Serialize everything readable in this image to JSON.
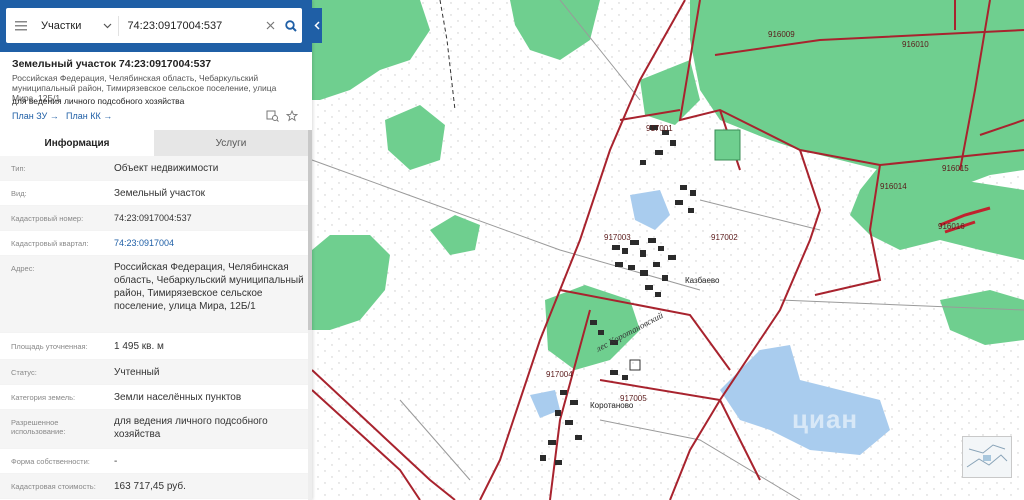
{
  "search": {
    "type_label": "Участки",
    "query": "74:23:0917004:537"
  },
  "parcel": {
    "title": "Земельный участок 74:23:0917004:537",
    "address_line": "Российская Федерация, Челябинская область, Чебаркульский муниципальный район, Тимирязевское сельское поселение, улица Мира, 12Б/1",
    "use": "для ведения личного подсобного хозяйства"
  },
  "links": {
    "plan_zu": "План ЗУ",
    "plan_kk": "План КК"
  },
  "tabs": [
    {
      "label": "Информация",
      "active": true
    },
    {
      "label": "Услуги",
      "active": false
    }
  ],
  "info": [
    {
      "label": "Тип:",
      "value": "Объект недвижимости"
    },
    {
      "label": "Вид:",
      "value": "Земельный участок"
    },
    {
      "label": "Кадастровый номер:",
      "value": "74:23:0917004:537"
    },
    {
      "label": "Кадастровый квартал:",
      "value": "74:23:0917004"
    },
    {
      "label": "Адрес:",
      "value": "Российская Федерация, Челябинская область, Чебаркульский муниципальный район, Тимирязевское сельское поселение, улица Мира, 12Б/1"
    },
    {
      "label": "Площадь уточненная:",
      "value": "1 495 кв. м"
    },
    {
      "label": "Статус:",
      "value": "Учтенный"
    },
    {
      "label": "Категория земель:",
      "value": "Земли населённых пунктов"
    },
    {
      "label": "Разрешенное использование:",
      "value": "для ведения личного подсобного хозяйства"
    },
    {
      "label": "Форма собственности:",
      "value": "-"
    },
    {
      "label": "Кадастровая стоимость:",
      "value": "163 717,45 руб."
    }
  ],
  "map": {
    "quarters": [
      "916009",
      "916010",
      "917001",
      "916014",
      "916015",
      "916016",
      "917003",
      "917002",
      "917004",
      "917005"
    ],
    "villages": [
      "Казбаево",
      "Коротаново"
    ],
    "forest_name": "лес Коротановский",
    "watermark": "циан",
    "colors": {
      "boundary": "#a8232e",
      "forest": "#6fcf8f",
      "water": "#a9ccee",
      "panel_header": "#1f5fa6"
    }
  }
}
